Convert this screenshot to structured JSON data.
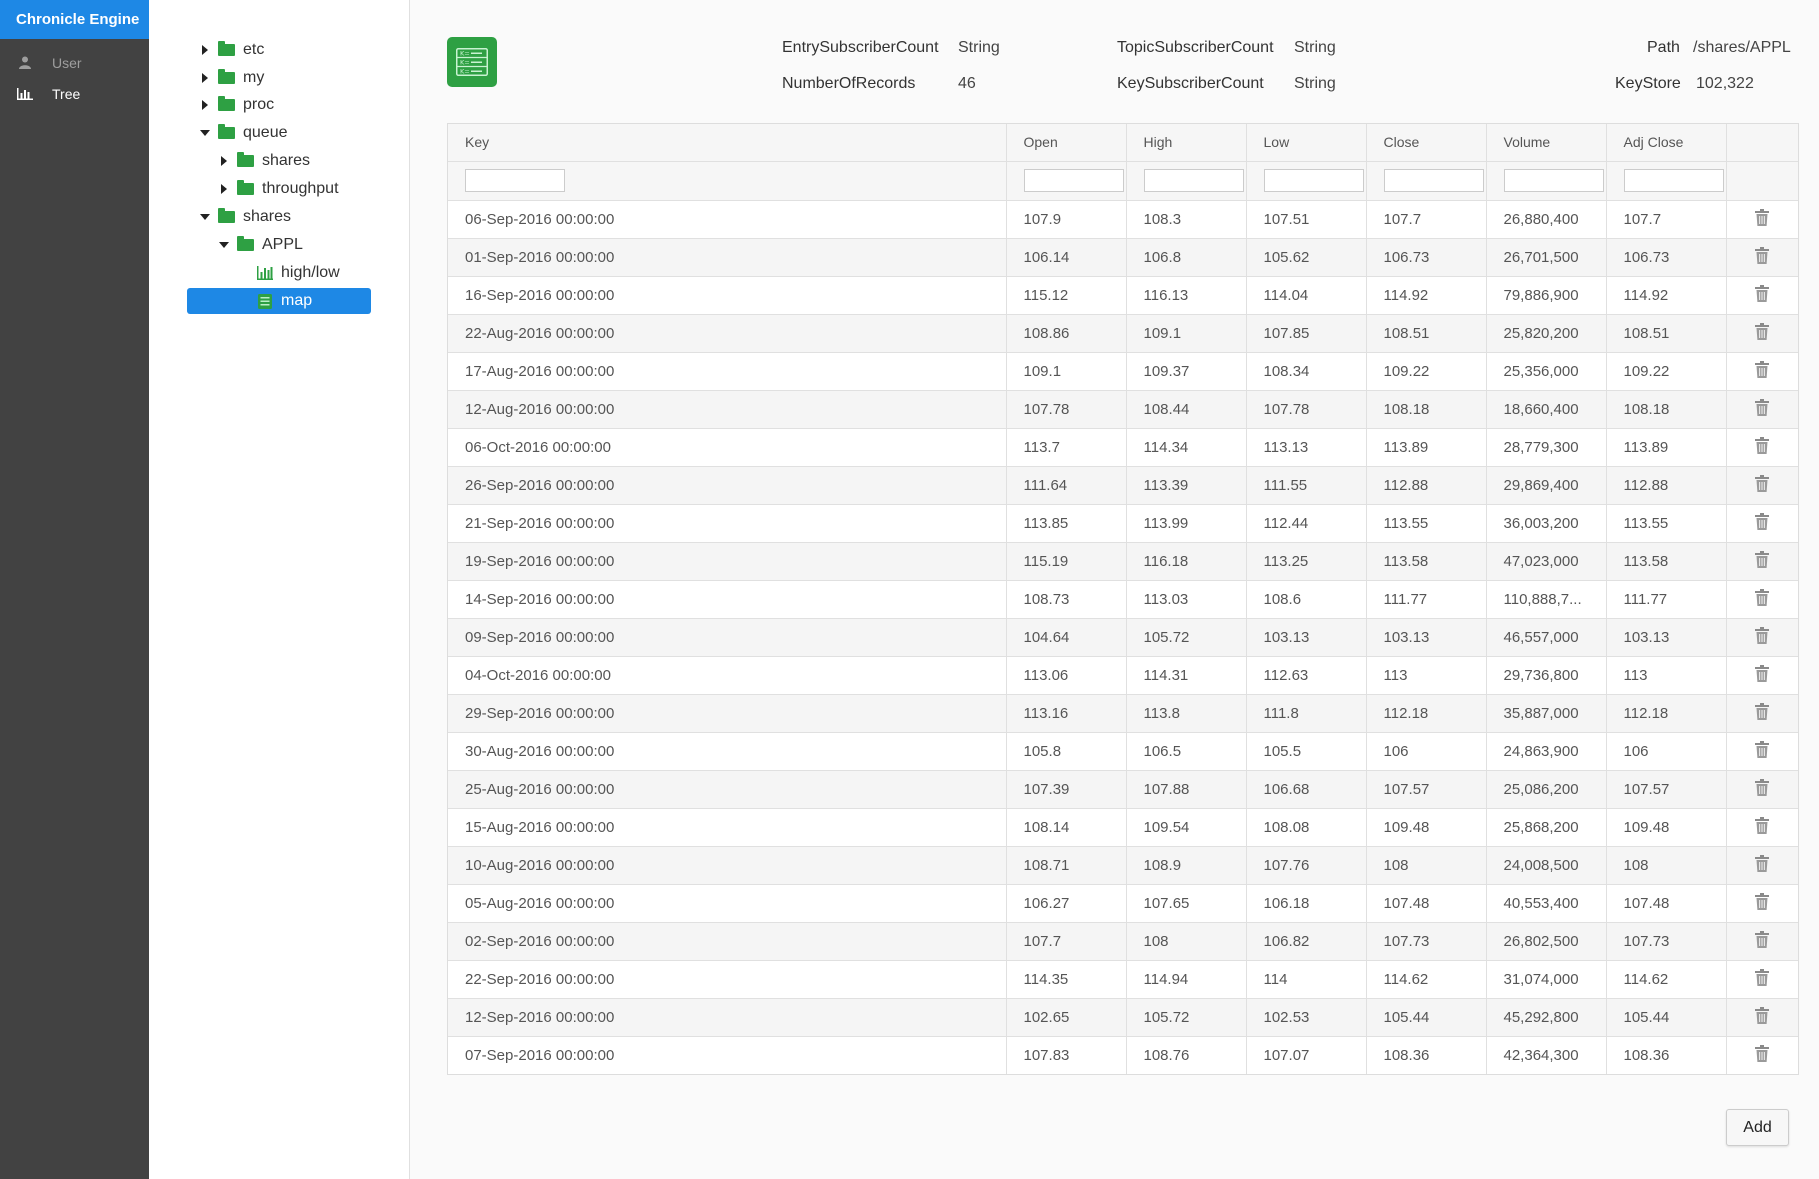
{
  "app": {
    "brand": "Chronicle Engine",
    "nav": [
      {
        "label": "User",
        "icon": "user-icon"
      },
      {
        "label": "Tree",
        "icon": "bar-chart-icon"
      }
    ]
  },
  "tree": {
    "nodes": [
      {
        "label": "etc",
        "expanded": false,
        "type": "folder"
      },
      {
        "label": "my",
        "expanded": false,
        "type": "folder"
      },
      {
        "label": "proc",
        "expanded": false,
        "type": "folder"
      },
      {
        "label": "queue",
        "expanded": true,
        "type": "folder"
      },
      {
        "label": "shares",
        "expanded": false,
        "type": "folder"
      },
      {
        "label": "throughput",
        "expanded": false,
        "type": "folder"
      },
      {
        "label": "shares",
        "expanded": true,
        "type": "folder"
      },
      {
        "label": "APPL",
        "expanded": true,
        "type": "folder"
      },
      {
        "label": "high/low",
        "type": "chart-leaf"
      },
      {
        "label": "map",
        "type": "map-leaf",
        "selected": true
      }
    ]
  },
  "meta": {
    "entry_subscriber_count_label": "EntrySubscriberCount",
    "entry_subscriber_count_value": "String",
    "number_of_records_label": "NumberOfRecords",
    "number_of_records_value": "46",
    "topic_subscriber_count_label": "TopicSubscriberCount",
    "topic_subscriber_count_value": "String",
    "key_subscriber_count_label": "KeySubscriberCount",
    "key_subscriber_count_value": "String",
    "path_label": "Path",
    "path_value": "/shares/APPL",
    "keystore_label": "KeyStore",
    "keystore_value": "102,322"
  },
  "table": {
    "columns": [
      "Key",
      "Open",
      "High",
      "Low",
      "Close",
      "Volume",
      "Adj Close"
    ],
    "rows": [
      [
        "06-Sep-2016 00:00:00",
        "107.9",
        "108.3",
        "107.51",
        "107.7",
        "26,880,400",
        "107.7"
      ],
      [
        "01-Sep-2016 00:00:00",
        "106.14",
        "106.8",
        "105.62",
        "106.73",
        "26,701,500",
        "106.73"
      ],
      [
        "16-Sep-2016 00:00:00",
        "115.12",
        "116.13",
        "114.04",
        "114.92",
        "79,886,900",
        "114.92"
      ],
      [
        "22-Aug-2016 00:00:00",
        "108.86",
        "109.1",
        "107.85",
        "108.51",
        "25,820,200",
        "108.51"
      ],
      [
        "17-Aug-2016 00:00:00",
        "109.1",
        "109.37",
        "108.34",
        "109.22",
        "25,356,000",
        "109.22"
      ],
      [
        "12-Aug-2016 00:00:00",
        "107.78",
        "108.44",
        "107.78",
        "108.18",
        "18,660,400",
        "108.18"
      ],
      [
        "06-Oct-2016 00:00:00",
        "113.7",
        "114.34",
        "113.13",
        "113.89",
        "28,779,300",
        "113.89"
      ],
      [
        "26-Sep-2016 00:00:00",
        "111.64",
        "113.39",
        "111.55",
        "112.88",
        "29,869,400",
        "112.88"
      ],
      [
        "21-Sep-2016 00:00:00",
        "113.85",
        "113.99",
        "112.44",
        "113.55",
        "36,003,200",
        "113.55"
      ],
      [
        "19-Sep-2016 00:00:00",
        "115.19",
        "116.18",
        "113.25",
        "113.58",
        "47,023,000",
        "113.58"
      ],
      [
        "14-Sep-2016 00:00:00",
        "108.73",
        "113.03",
        "108.6",
        "111.77",
        "110,888,7...",
        "111.77"
      ],
      [
        "09-Sep-2016 00:00:00",
        "104.64",
        "105.72",
        "103.13",
        "103.13",
        "46,557,000",
        "103.13"
      ],
      [
        "04-Oct-2016 00:00:00",
        "113.06",
        "114.31",
        "112.63",
        "113",
        "29,736,800",
        "113"
      ],
      [
        "29-Sep-2016 00:00:00",
        "113.16",
        "113.8",
        "111.8",
        "112.18",
        "35,887,000",
        "112.18"
      ],
      [
        "30-Aug-2016 00:00:00",
        "105.8",
        "106.5",
        "105.5",
        "106",
        "24,863,900",
        "106"
      ],
      [
        "25-Aug-2016 00:00:00",
        "107.39",
        "107.88",
        "106.68",
        "107.57",
        "25,086,200",
        "107.57"
      ],
      [
        "15-Aug-2016 00:00:00",
        "108.14",
        "109.54",
        "108.08",
        "109.48",
        "25,868,200",
        "109.48"
      ],
      [
        "10-Aug-2016 00:00:00",
        "108.71",
        "108.9",
        "107.76",
        "108",
        "24,008,500",
        "108"
      ],
      [
        "05-Aug-2016 00:00:00",
        "106.27",
        "107.65",
        "106.18",
        "107.48",
        "40,553,400",
        "107.48"
      ],
      [
        "02-Sep-2016 00:00:00",
        "107.7",
        "108",
        "106.82",
        "107.73",
        "26,802,500",
        "107.73"
      ],
      [
        "22-Sep-2016 00:00:00",
        "114.35",
        "114.94",
        "114",
        "114.62",
        "31,074,000",
        "114.62"
      ],
      [
        "12-Sep-2016 00:00:00",
        "102.65",
        "105.72",
        "102.53",
        "105.44",
        "45,292,800",
        "105.44"
      ],
      [
        "07-Sep-2016 00:00:00",
        "107.83",
        "108.76",
        "107.07",
        "108.36",
        "42,364,300",
        "108.36"
      ]
    ]
  },
  "actions": {
    "add_label": "Add"
  },
  "colors": {
    "accent": "#1e88e5",
    "folder": "#2ea043",
    "nav_bg": "#424242"
  }
}
